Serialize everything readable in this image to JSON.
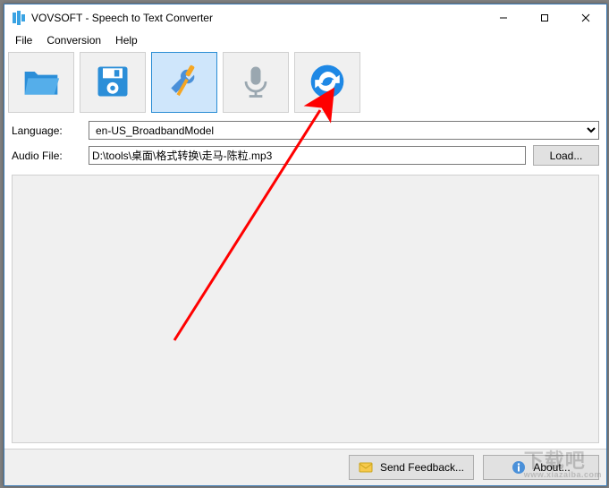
{
  "window": {
    "title": "VOVSOFT - Speech to Text Converter"
  },
  "menubar": {
    "file": "File",
    "conversion": "Conversion",
    "help": "Help"
  },
  "toolbar": {
    "open_name": "open",
    "save_name": "save",
    "settings_name": "settings",
    "record_name": "record",
    "convert_name": "convert"
  },
  "form": {
    "language_label": "Language:",
    "language_value": "en-US_BroadbandModel",
    "audio_label": "Audio File:",
    "audio_value": "D:\\tools\\桌面\\格式转换\\走马-陈粒.mp3",
    "load_button": "Load..."
  },
  "bottom": {
    "feedback": "Send Feedback...",
    "about": "About..."
  },
  "watermark": {
    "main": "下载吧",
    "sub": "www.xiazaiba.com"
  }
}
